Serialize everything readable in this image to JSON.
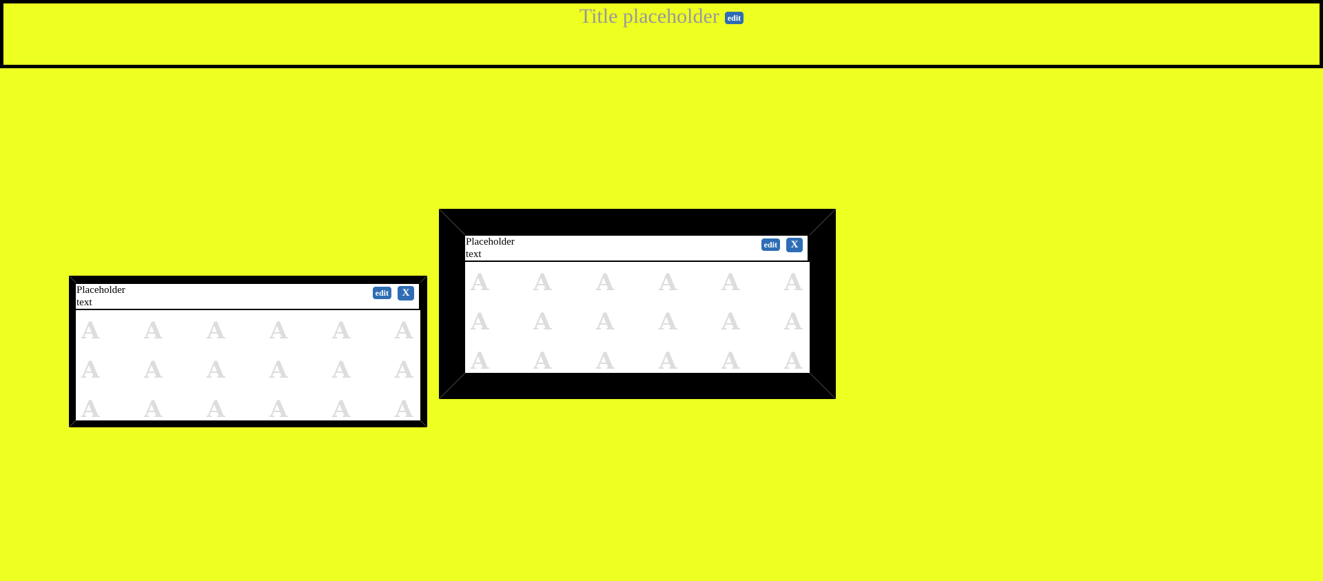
{
  "header": {
    "title": "Title placeholder",
    "edit_label": "edit"
  },
  "cards": [
    {
      "label": "Placeholder\ntext",
      "edit_label": "edit",
      "close_label": "X",
      "watermark": "A"
    },
    {
      "label": "Placeholder\ntext",
      "edit_label": "edit",
      "close_label": "X",
      "watermark": "A"
    }
  ],
  "colors": {
    "background": "#eeff22",
    "frame": "#000000",
    "button": "#2e6db4",
    "title_text": "#999999",
    "watermark": "#dddddd"
  }
}
